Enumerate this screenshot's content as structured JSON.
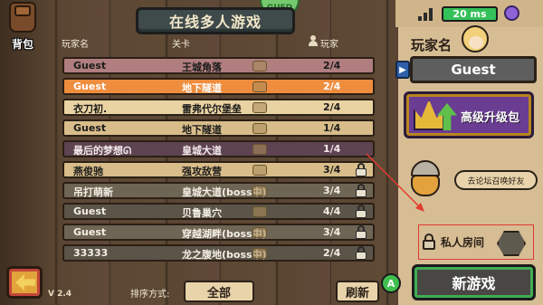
{
  "header": {
    "title": "在线多人游戏",
    "bag_label": "背包",
    "top_bubble": "GUED"
  },
  "columns": {
    "player": "玩家名",
    "level": "关卡",
    "count": "玩家"
  },
  "rooms": [
    {
      "name": "Guest",
      "level": "王城角落",
      "count": "2/4",
      "style": "rose",
      "locked": false
    },
    {
      "name": "Guest",
      "level": "地下隧道",
      "count": "2/4",
      "style": "orange",
      "locked": false
    },
    {
      "name": "衣刀初.",
      "level": "雷弗代尔堡垒",
      "count": "2/4",
      "style": "cream",
      "locked": false
    },
    {
      "name": "Guest",
      "level": "地下隧道",
      "count": "1/4",
      "style": "tan",
      "locked": false
    },
    {
      "name": "最后的梦想ᘏ",
      "level": "皇城大道",
      "count": "1/4",
      "style": "mauve",
      "locked": false
    },
    {
      "name": "燕俊驰",
      "level": "强攻敌营",
      "count": "3/4",
      "style": "tan",
      "locked": true
    },
    {
      "name": "吊打萌新",
      "level": "皇城大道(boss中)",
      "count": "3/4",
      "style": "gray",
      "locked": true
    },
    {
      "name": "Guest",
      "level": "贝鲁巢穴",
      "count": "4/4",
      "style": "gray2",
      "locked": true
    },
    {
      "name": "Guest",
      "level": "穿越湖畔(boss中)",
      "count": "3/4",
      "style": "gray",
      "locked": true
    },
    {
      "name": "33333",
      "level": "龙之腹地(boss中)",
      "count": "2/4",
      "style": "gray2",
      "locked": true
    }
  ],
  "right": {
    "ping": "20 ms",
    "player_name_label": "玩家名",
    "player_name": "Guest",
    "upgrade_label": "高级升级包",
    "forum_label": "去论坛召唤好友",
    "private_label": "私人房间",
    "new_game_label": "新游戏"
  },
  "bottom": {
    "version": "V 2.4",
    "sort_label": "排序方式:",
    "sort_value": "全部",
    "refresh_label": "刷新",
    "a_button": "A"
  },
  "colors": {
    "accent_green": "#35c15a",
    "highlight_orange": "#ef8d3e",
    "annotation_red": "#e03c30",
    "upgrade_purple": "#6a3d93"
  },
  "icons": [
    "bag-icon",
    "player-icon",
    "signal-icon",
    "gem-icon",
    "crown-icon",
    "lock-icon",
    "back-arrow-icon",
    "viking-avatar",
    "player-avatar"
  ]
}
